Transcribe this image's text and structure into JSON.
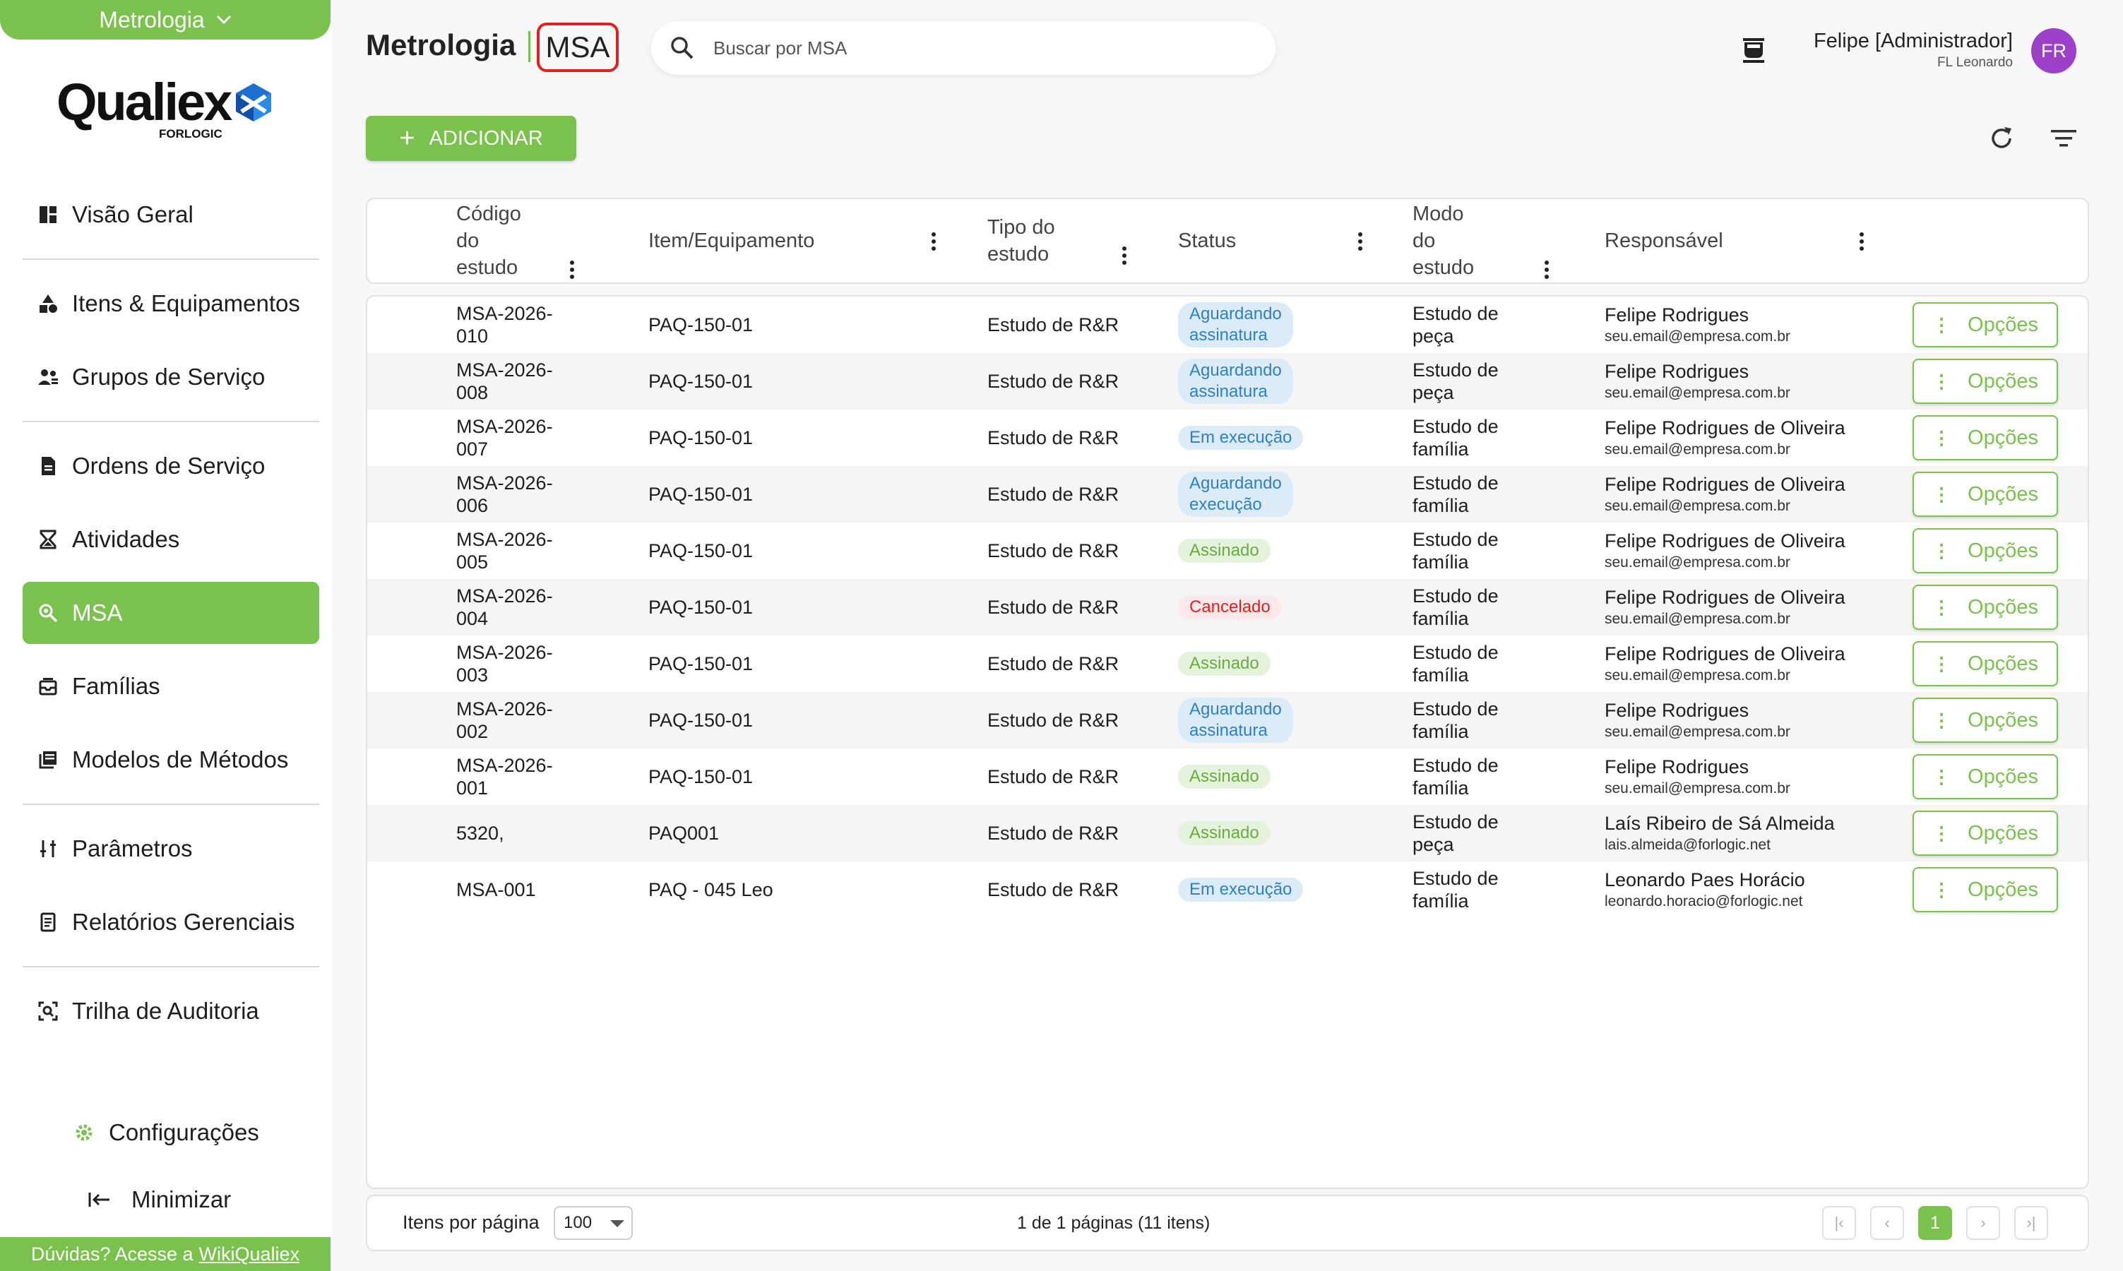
{
  "sidebar": {
    "module": "Metrologia",
    "logo_text": "Qualiex",
    "logo_sub": "FORLOGIC",
    "items": [
      {
        "label": "Visão Geral",
        "icon": "dashboard-icon"
      },
      {
        "label": "Itens & Equipamentos",
        "icon": "shapes-icon"
      },
      {
        "label": "Grupos de Serviço",
        "icon": "group-icon"
      },
      {
        "label": "Ordens de Serviço",
        "icon": "document-icon"
      },
      {
        "label": "Atividades",
        "icon": "hourglass-icon"
      },
      {
        "label": "MSA",
        "icon": "zoom-icon"
      },
      {
        "label": "Famílias",
        "icon": "inbox-icon"
      },
      {
        "label": "Modelos de Métodos",
        "icon": "library-icon"
      },
      {
        "label": "Parâmetros",
        "icon": "tune-icon"
      },
      {
        "label": "Relatórios Gerenciais",
        "icon": "report-icon"
      },
      {
        "label": "Trilha de Auditoria",
        "icon": "audit-icon"
      }
    ],
    "active": "MSA",
    "config_label": "Configurações",
    "minimize_label": "Minimizar",
    "help_text": "Dúvidas? Acesse a",
    "help_link": "WikiQualiex"
  },
  "header": {
    "title": "Metrologia",
    "module": "MSA",
    "search_placeholder": "Buscar por MSA",
    "user_name": "Felipe [Administrador]",
    "user_sub": "FL Leonardo",
    "avatar_initials": "FR"
  },
  "toolbar": {
    "add_label": "ADICIONAR"
  },
  "table": {
    "columns": [
      {
        "label": "Código\ndo\nestudo"
      },
      {
        "label": "Item/Equipamento"
      },
      {
        "label": "Tipo do\nestudo"
      },
      {
        "label": "Status"
      },
      {
        "label": "Modo\ndo\nestudo"
      },
      {
        "label": "Responsável"
      }
    ],
    "options_label": "Opções",
    "rows": [
      {
        "code": "MSA-2026-\n010",
        "item": "PAQ-150-01",
        "type": "Estudo de R&R",
        "status": "Aguardando\nassinatura",
        "status_color": "blue",
        "mode": "Estudo de\npeça",
        "resp_name": "Felipe Rodrigues",
        "resp_email": "seu.email@empresa.com.br"
      },
      {
        "code": "MSA-2026-\n008",
        "item": "PAQ-150-01",
        "type": "Estudo de R&R",
        "status": "Aguardando\nassinatura",
        "status_color": "blue",
        "mode": "Estudo de\npeça",
        "resp_name": "Felipe Rodrigues",
        "resp_email": "seu.email@empresa.com.br"
      },
      {
        "code": "MSA-2026-\n007",
        "item": "PAQ-150-01",
        "type": "Estudo de R&R",
        "status": "Em execução",
        "status_color": "blue",
        "mode": "Estudo de\nfamília",
        "resp_name": "Felipe Rodrigues de Oliveira",
        "resp_email": "seu.email@empresa.com.br"
      },
      {
        "code": "MSA-2026-\n006",
        "item": "PAQ-150-01",
        "type": "Estudo de R&R",
        "status": "Aguardando\nexecução",
        "status_color": "blue",
        "mode": "Estudo de\nfamília",
        "resp_name": "Felipe Rodrigues de Oliveira",
        "resp_email": "seu.email@empresa.com.br"
      },
      {
        "code": "MSA-2026-\n005",
        "item": "PAQ-150-01",
        "type": "Estudo de R&R",
        "status": "Assinado",
        "status_color": "green",
        "mode": "Estudo de\nfamília",
        "resp_name": "Felipe Rodrigues de Oliveira",
        "resp_email": "seu.email@empresa.com.br"
      },
      {
        "code": "MSA-2026-\n004",
        "item": "PAQ-150-01",
        "type": "Estudo de R&R",
        "status": "Cancelado",
        "status_color": "red",
        "mode": "Estudo de\nfamília",
        "resp_name": "Felipe Rodrigues de Oliveira",
        "resp_email": "seu.email@empresa.com.br"
      },
      {
        "code": "MSA-2026-\n003",
        "item": "PAQ-150-01",
        "type": "Estudo de R&R",
        "status": "Assinado",
        "status_color": "green",
        "mode": "Estudo de\nfamília",
        "resp_name": "Felipe Rodrigues de Oliveira",
        "resp_email": "seu.email@empresa.com.br"
      },
      {
        "code": "MSA-2026-\n002",
        "item": "PAQ-150-01",
        "type": "Estudo de R&R",
        "status": "Aguardando\nassinatura",
        "status_color": "blue",
        "mode": "Estudo de\nfamília",
        "resp_name": "Felipe Rodrigues",
        "resp_email": "seu.email@empresa.com.br"
      },
      {
        "code": "MSA-2026-\n001",
        "item": "PAQ-150-01",
        "type": "Estudo de R&R",
        "status": "Assinado",
        "status_color": "green",
        "mode": "Estudo de\nfamília",
        "resp_name": "Felipe Rodrigues",
        "resp_email": "seu.email@empresa.com.br"
      },
      {
        "code": "5320,",
        "item": "PAQ001",
        "type": "Estudo de R&R",
        "status": "Assinado",
        "status_color": "green",
        "mode": "Estudo de\npeça",
        "resp_name": "Laís Ribeiro de Sá Almeida",
        "resp_email": "lais.almeida@forlogic.net"
      },
      {
        "code": "MSA-001",
        "item": "PAQ - 045 Leo",
        "type": "Estudo de R&R",
        "status": "Em execução",
        "status_color": "blue",
        "mode": "Estudo de\nfamília",
        "resp_name": "Leonardo Paes Horácio",
        "resp_email": "leonardo.horacio@forlogic.net"
      }
    ]
  },
  "footer": {
    "per_page_label": "Itens por página",
    "per_page_value": "100",
    "page_info": "1 de 1 páginas (11 itens)",
    "current_page": "1"
  },
  "colors": {
    "accent": "#7ac14e",
    "status_blue": "#2f7fc4",
    "status_green": "#6aab3f",
    "status_red": "#e02020",
    "avatar": "#9c3fc9"
  }
}
